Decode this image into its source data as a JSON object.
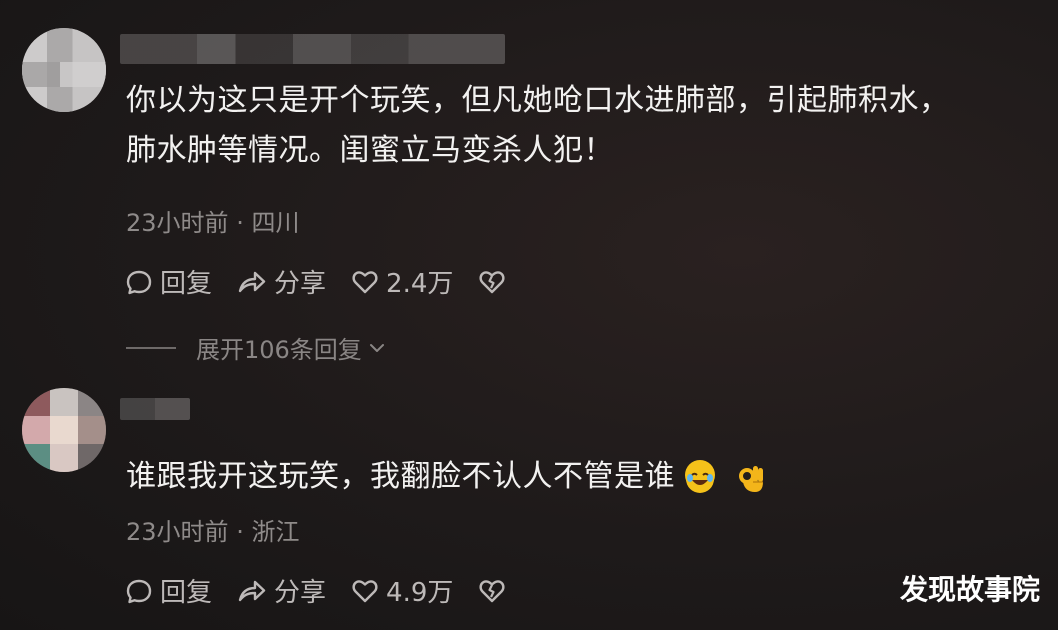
{
  "comments": [
    {
      "text_line1": "你以为这只是开个玩笑，但凡她呛口水进肺部，引起肺积水，",
      "text_line2": "肺水肿等情况。闺蜜立马变杀人犯！",
      "time": "23小时前",
      "location": "四川",
      "reply_label": "回复",
      "share_label": "分享",
      "likes": "2.4万",
      "expand_label": "展开106条回复"
    },
    {
      "text_line1": "谁跟我开这玩笑，我翻脸不认人不管是谁",
      "time": "23小时前",
      "location": "浙江",
      "reply_label": "回复",
      "share_label": "分享",
      "likes": "4.9万",
      "emojis": [
        "laughing-crying-emoji",
        "ok-hand-emoji"
      ]
    }
  ],
  "watermark": "发现故事院",
  "colors": {
    "background": "#1e1a1a",
    "text": "#f2f1f0",
    "meta": "#8f8b8a",
    "action": "#bdb9b8"
  }
}
